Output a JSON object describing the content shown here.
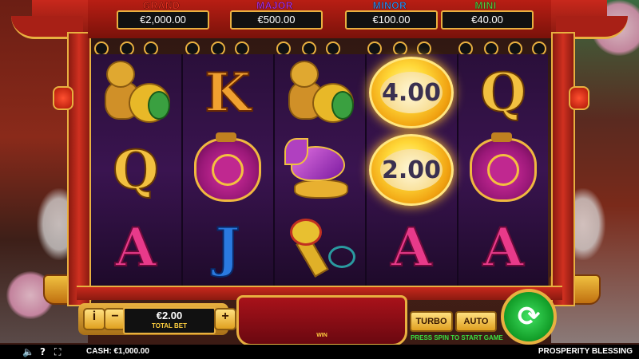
{
  "jackpots": [
    {
      "name": "GRAND",
      "value": "€2,000.00",
      "color": "#e83020"
    },
    {
      "name": "MAJOR",
      "value": "€500.00",
      "color": "#b030e0"
    },
    {
      "name": "MINOR",
      "value": "€100.00",
      "color": "#3a8ae8"
    },
    {
      "name": "MINI",
      "value": "€40.00",
      "color": "#5ad040"
    }
  ],
  "reels": {
    "coin_1": "4.00",
    "coin_2": "2.00",
    "letters": {
      "k": "K",
      "q1": "Q",
      "q2": "Q",
      "a1": "A",
      "j": "J",
      "a2": "A",
      "a3": "A"
    }
  },
  "controls": {
    "info": "i",
    "minus": "−",
    "plus": "+",
    "bet_value": "€2.00",
    "bet_label": "TOTAL BET",
    "win_label": "WIN",
    "turbo": "TURBO",
    "auto": "AUTO",
    "press_spin": "PRESS SPIN TO START GAME",
    "spin_icon": "⟳"
  },
  "status": {
    "sound_icon": "speaker-icon",
    "help": "?",
    "fullscreen_icon": "fullscreen-icon",
    "cash": "CASH:  €1,000.00",
    "game_name": "PROSPERITY BLESSING"
  },
  "colors": {
    "accent_gold": "#e8b040",
    "frame_red": "#c8281c",
    "spin_green": "#14a02a",
    "press_text": "#3ae040"
  }
}
